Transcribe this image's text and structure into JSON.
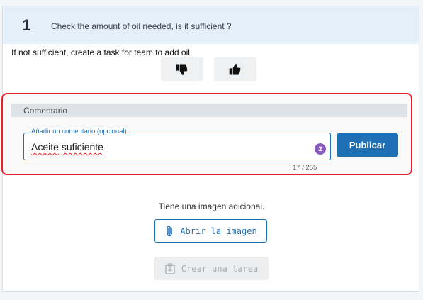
{
  "question": {
    "number": "1",
    "text": "Check the amount of oil needed, is it sufficient ?"
  },
  "instruction": "If not sufficient, create a task for team to add oil.",
  "rating": {
    "thumb_down_icon": "thumbs-down-icon",
    "thumb_up_icon": "thumbs-up-icon"
  },
  "comment": {
    "section_label": "Comentario",
    "field_label": "Añadir un comentario (opcional)",
    "value_word_1": "Aceite",
    "value_word_2": "suficiente",
    "spell_badge": "2",
    "char_count": "17 / 255",
    "publish_label": "Publicar"
  },
  "attachment": {
    "info_text": "Tiene una imagen adicional.",
    "open_label": "Abrir la imagen",
    "open_icon": "paperclip-icon"
  },
  "task": {
    "create_label": "Crear una tarea",
    "create_icon": "add-task-icon",
    "enabled": false
  },
  "colors": {
    "accent": "#1f6fb5",
    "header_bg": "#e4eff9",
    "highlight": "#e8202a",
    "badge": "#8a5cc2"
  }
}
